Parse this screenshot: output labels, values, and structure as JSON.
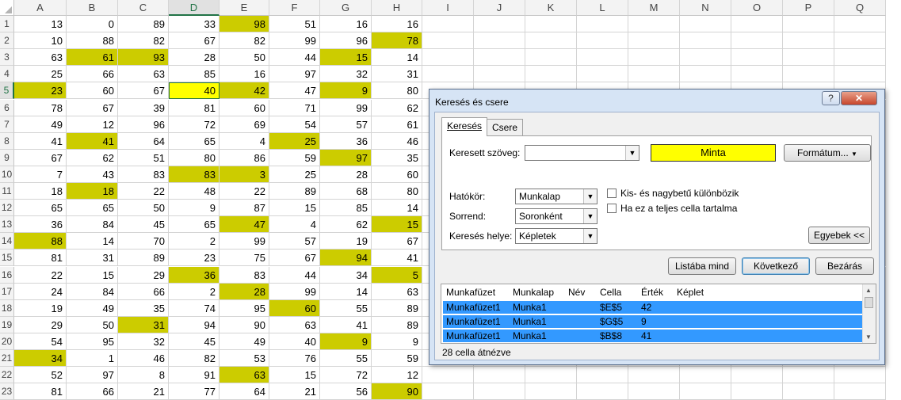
{
  "sheet": {
    "columns": [
      "A",
      "B",
      "C",
      "D",
      "E",
      "F",
      "G",
      "H",
      "I",
      "J",
      "K",
      "L",
      "M",
      "N",
      "O",
      "P",
      "Q"
    ],
    "selected_column": "D",
    "selected_row": 5,
    "rows": [
      {
        "n": 1,
        "v": [
          13,
          0,
          89,
          33,
          98,
          51,
          16,
          16
        ],
        "h": [
          0,
          0,
          0,
          0,
          1,
          0,
          0,
          0
        ]
      },
      {
        "n": 2,
        "v": [
          10,
          88,
          82,
          67,
          82,
          99,
          96,
          78
        ],
        "h": [
          0,
          0,
          0,
          0,
          0,
          0,
          0,
          1
        ]
      },
      {
        "n": 3,
        "v": [
          63,
          61,
          93,
          28,
          50,
          44,
          15,
          14
        ],
        "h": [
          0,
          1,
          1,
          0,
          0,
          0,
          1,
          0
        ]
      },
      {
        "n": 4,
        "v": [
          25,
          66,
          63,
          85,
          16,
          97,
          32,
          31
        ],
        "h": [
          0,
          0,
          0,
          0,
          0,
          0,
          0,
          0
        ]
      },
      {
        "n": 5,
        "v": [
          23,
          60,
          67,
          40,
          42,
          47,
          9,
          80
        ],
        "h": [
          1,
          0,
          0,
          2,
          1,
          0,
          1,
          0
        ]
      },
      {
        "n": 6,
        "v": [
          78,
          67,
          39,
          81,
          60,
          71,
          99,
          62
        ],
        "h": [
          0,
          0,
          0,
          0,
          0,
          0,
          0,
          0
        ]
      },
      {
        "n": 7,
        "v": [
          49,
          12,
          96,
          72,
          69,
          54,
          57,
          61
        ],
        "h": [
          0,
          0,
          0,
          0,
          0,
          0,
          0,
          0
        ]
      },
      {
        "n": 8,
        "v": [
          41,
          41,
          64,
          65,
          4,
          25,
          36,
          46
        ],
        "h": [
          0,
          1,
          0,
          0,
          0,
          1,
          0,
          0
        ]
      },
      {
        "n": 9,
        "v": [
          67,
          62,
          51,
          80,
          86,
          59,
          97,
          35
        ],
        "h": [
          0,
          0,
          0,
          0,
          0,
          0,
          1,
          0
        ]
      },
      {
        "n": 10,
        "v": [
          7,
          43,
          83,
          83,
          3,
          25,
          28,
          60
        ],
        "h": [
          0,
          0,
          0,
          1,
          1,
          0,
          0,
          0
        ]
      },
      {
        "n": 11,
        "v": [
          18,
          18,
          22,
          48,
          22,
          89,
          68,
          80
        ],
        "h": [
          0,
          1,
          0,
          0,
          0,
          0,
          0,
          0
        ]
      },
      {
        "n": 12,
        "v": [
          65,
          65,
          50,
          9,
          87,
          15,
          85,
          14
        ],
        "h": [
          0,
          0,
          0,
          0,
          0,
          0,
          0,
          0
        ]
      },
      {
        "n": 13,
        "v": [
          36,
          84,
          45,
          65,
          47,
          4,
          62,
          15
        ],
        "h": [
          0,
          0,
          0,
          0,
          1,
          0,
          0,
          1
        ]
      },
      {
        "n": 14,
        "v": [
          88,
          14,
          70,
          2,
          99,
          57,
          19,
          67
        ],
        "h": [
          1,
          0,
          0,
          0,
          0,
          0,
          0,
          0
        ]
      },
      {
        "n": 15,
        "v": [
          81,
          31,
          89,
          23,
          75,
          67,
          94,
          41
        ],
        "h": [
          0,
          0,
          0,
          0,
          0,
          0,
          1,
          0
        ]
      },
      {
        "n": 16,
        "v": [
          22,
          15,
          29,
          36,
          83,
          44,
          34,
          5
        ],
        "h": [
          0,
          0,
          0,
          1,
          0,
          0,
          0,
          1
        ]
      },
      {
        "n": 17,
        "v": [
          24,
          84,
          66,
          2,
          28,
          99,
          14,
          63
        ],
        "h": [
          0,
          0,
          0,
          0,
          1,
          0,
          0,
          0
        ]
      },
      {
        "n": 18,
        "v": [
          19,
          49,
          35,
          74,
          95,
          60,
          55,
          89
        ],
        "h": [
          0,
          0,
          0,
          0,
          0,
          1,
          0,
          0
        ]
      },
      {
        "n": 19,
        "v": [
          29,
          50,
          31,
          94,
          90,
          63,
          41,
          89
        ],
        "h": [
          0,
          0,
          1,
          0,
          0,
          0,
          0,
          0
        ]
      },
      {
        "n": 20,
        "v": [
          54,
          95,
          32,
          45,
          49,
          40,
          9,
          9
        ],
        "h": [
          0,
          0,
          0,
          0,
          0,
          0,
          1,
          0
        ]
      },
      {
        "n": 21,
        "v": [
          34,
          1,
          46,
          82,
          53,
          76,
          55,
          59
        ],
        "h": [
          1,
          0,
          0,
          0,
          0,
          0,
          0,
          0
        ]
      },
      {
        "n": 22,
        "v": [
          52,
          97,
          8,
          91,
          63,
          15,
          72,
          12
        ],
        "h": [
          0,
          0,
          0,
          0,
          1,
          0,
          0,
          0
        ]
      },
      {
        "n": 23,
        "v": [
          81,
          66,
          21,
          77,
          64,
          21,
          56,
          90
        ],
        "h": [
          0,
          0,
          0,
          0,
          0,
          0,
          0,
          1
        ]
      }
    ],
    "highlight_color": "#cccc00",
    "active_color": "#ffff00"
  },
  "dialog": {
    "title": "Keresés és csere",
    "help_label": "?",
    "close_label": "✕",
    "tabs": [
      "Keresés",
      "Csere"
    ],
    "find_label": "Keresett szöveg:",
    "find_value": "",
    "preview_text": "Minta",
    "format_button": "Formátum...",
    "scope_label": "Hatókör:",
    "scope_value": "Munkalap",
    "order_label": "Sorrend:",
    "order_value": "Soronként",
    "lookin_label": "Keresés helye:",
    "lookin_value": "Képletek",
    "match_case_label": "Kis- és nagybetű különbözik",
    "whole_cell_label": "Ha ez a teljes cella tartalma",
    "options_button": "Egyebek <<",
    "find_all_button": "Listába mind",
    "find_next_button": "Következő",
    "close_button": "Bezárás",
    "result_headers": [
      "Munkafüzet",
      "Munkalap",
      "Név",
      "Cella",
      "Érték",
      "Képlet"
    ],
    "results": [
      {
        "book": "Munkafüzet1",
        "sheet": "Munka1",
        "name": "",
        "cell": "$E$5",
        "value": "42",
        "formula": ""
      },
      {
        "book": "Munkafüzet1",
        "sheet": "Munka1",
        "name": "",
        "cell": "$G$5",
        "value": "9",
        "formula": ""
      },
      {
        "book": "Munkafüzet1",
        "sheet": "Munka1",
        "name": "",
        "cell": "$B$8",
        "value": "41",
        "formula": ""
      }
    ],
    "status": "28 cella átnézve"
  }
}
